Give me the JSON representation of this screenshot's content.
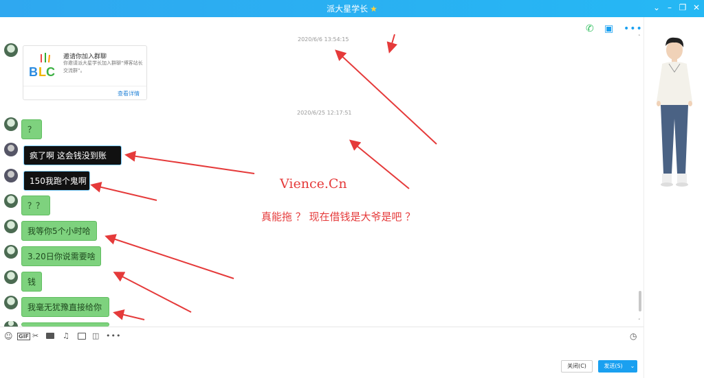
{
  "window": {
    "title": "派大星学长",
    "title_icon": "star-icon"
  },
  "header_icons": [
    "phone-icon",
    "video-icon",
    "more-icon"
  ],
  "timestamps": [
    "2020/6/6 13:54:15",
    "2020/6/25 12:17:51"
  ],
  "card": {
    "title": "邀请你加入群聊",
    "desc": "你邀请派大星学长加入群聊“博客站长交流群”。",
    "link": "查看详情",
    "logo_text": "BLC"
  },
  "messages": [
    {
      "text": "？",
      "style": "green"
    },
    {
      "text": "疯了啊   这会钱没到账",
      "style": "black"
    },
    {
      "text": "150我跑个鬼啊",
      "style": "black"
    },
    {
      "text": "？？",
      "style": "green"
    },
    {
      "text": "我等你5个小时哈",
      "style": "green"
    },
    {
      "text": "3.20日你说需要啥",
      "style": "green"
    },
    {
      "text": "钱",
      "style": "green"
    },
    {
      "text": "我毫无犹豫直接给你",
      "style": "green"
    }
  ],
  "annotations": {
    "watermark": "Vience.Cn",
    "comment": "真能拖 ？ 现在借钱是大爷是吧 ？"
  },
  "toolbar": {
    "icons": [
      "emoji-icon",
      "gif-icon",
      "scissors-icon",
      "folder-icon",
      "music-icon",
      "image-icon",
      "shake-icon",
      "more-icon",
      "history-icon"
    ],
    "gif_label": "GIF"
  },
  "buttons": {
    "close": "关闭(C)",
    "send": "发送(S)"
  },
  "colors": {
    "titlebar": "#2fa8f0",
    "bubble_green": "#7ed27e",
    "bubble_black": "#111111",
    "annotation": "#e53a3a",
    "send": "#1aa0f0"
  }
}
